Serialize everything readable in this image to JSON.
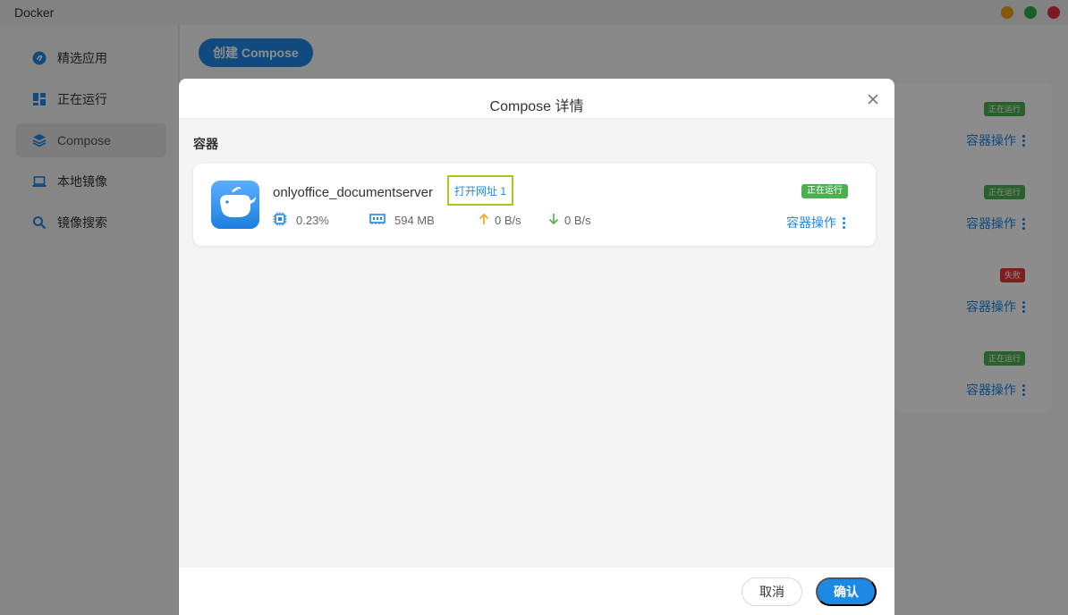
{
  "app": {
    "title": "Docker"
  },
  "sidebar": {
    "items": [
      {
        "label": "精选应用",
        "icon": "featured-apps-icon"
      },
      {
        "label": "正在运行",
        "icon": "running-dashboard-icon"
      },
      {
        "label": "Compose",
        "icon": "layers-icon",
        "active": true
      },
      {
        "label": "本地镜像",
        "icon": "laptop-icon"
      },
      {
        "label": "镜像搜索",
        "icon": "search-icon"
      }
    ]
  },
  "main": {
    "create_button": "创建 Compose",
    "compose_cards": [
      {
        "status": "正在运行",
        "status_color": "#4caf50",
        "action": "容器操作"
      },
      {
        "status": "正在运行",
        "status_color": "#4caf50",
        "action": "容器操作"
      },
      {
        "status": "失败",
        "status_color": "#e53935",
        "action": "容器操作"
      },
      {
        "status": "正在运行",
        "status_color": "#4caf50",
        "action": "容器操作"
      }
    ]
  },
  "modal": {
    "title": "Compose 详情",
    "section_label": "容器",
    "container": {
      "name": "onlyoffice_documentserver",
      "open_url": "打开网址 1",
      "status": "正在运行",
      "cpu": "0.23%",
      "memory": "594 MB",
      "upload": "0 B/s",
      "download": "0 B/s",
      "action": "容器操作"
    },
    "cancel": "取消",
    "confirm": "确认"
  },
  "colors": {
    "accent": "#1e88e5",
    "running": "#4caf50",
    "failed": "#e53935",
    "highlight_border": "#a8c81c",
    "upload_arrow": "#f0a21b",
    "download_arrow": "#4caf50"
  }
}
